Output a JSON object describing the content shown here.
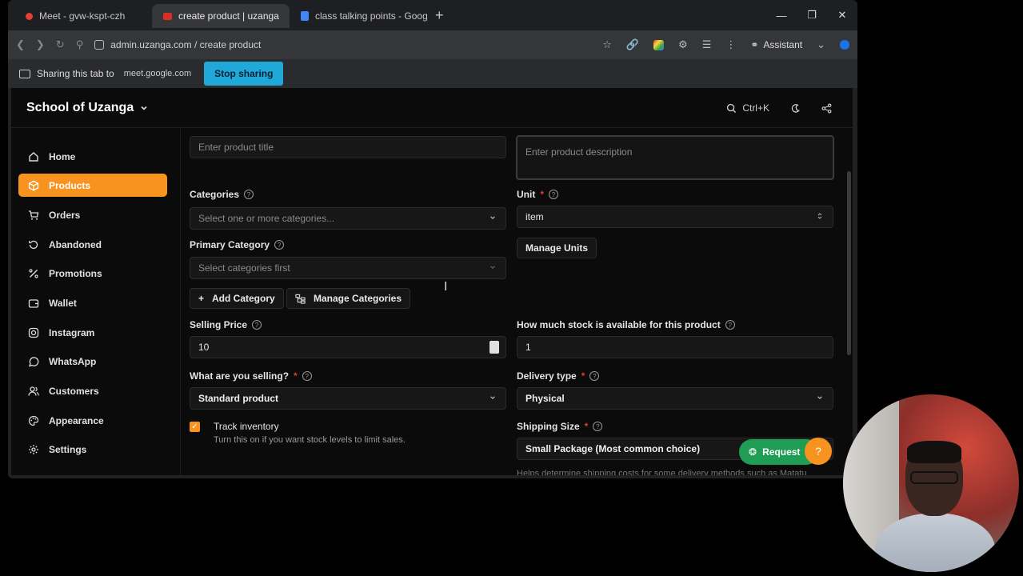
{
  "browser": {
    "tabs": [
      {
        "title": "Meet - gvw-kspt-czh",
        "active": false
      },
      {
        "title": "create product | uzanga",
        "active": true
      },
      {
        "title": "class talking points - Goog",
        "active": false
      }
    ],
    "url": "admin.uzanga.com / create product",
    "assistant_label": "Assistant"
  },
  "share_bar": {
    "text": "Sharing this tab to",
    "host": "meet.google.com",
    "stop_label": "Stop sharing"
  },
  "app": {
    "brand": "School of Uzanga",
    "search_shortcut": "Ctrl+K"
  },
  "sidebar": {
    "items": [
      {
        "label": "Home",
        "icon": "home-icon",
        "active": false
      },
      {
        "label": "Products",
        "icon": "box-icon",
        "active": true
      },
      {
        "label": "Orders",
        "icon": "cart-icon",
        "active": false
      },
      {
        "label": "Abandoned",
        "icon": "history-icon",
        "active": false
      },
      {
        "label": "Promotions",
        "icon": "percent-icon",
        "active": false
      },
      {
        "label": "Wallet",
        "icon": "wallet-icon",
        "active": false
      },
      {
        "label": "Instagram",
        "icon": "instagram-icon",
        "active": false
      },
      {
        "label": "WhatsApp",
        "icon": "whatsapp-icon",
        "active": false
      },
      {
        "label": "Customers",
        "icon": "users-icon",
        "active": false
      },
      {
        "label": "Appearance",
        "icon": "palette-icon",
        "active": false
      },
      {
        "label": "Settings",
        "icon": "gear-icon",
        "active": false
      }
    ]
  },
  "form": {
    "title_placeholder": "Enter product title",
    "description_placeholder": "Enter product description",
    "categories_label": "Categories",
    "categories_placeholder": "Select one or more categories...",
    "unit_label": "Unit",
    "unit_value": "item",
    "manage_units": "Manage Units",
    "primary_category_label": "Primary Category",
    "primary_category_placeholder": "Select categories first",
    "add_category": "Add Category",
    "manage_categories": "Manage Categories",
    "selling_price_label": "Selling Price",
    "selling_price_value": "10",
    "stock_label": "How much stock is available for this product",
    "stock_value": "1",
    "selling_type_label": "What are you selling?",
    "selling_type_value": "Standard product",
    "delivery_type_label": "Delivery type",
    "delivery_type_value": "Physical",
    "track_inventory_label": "Track inventory",
    "track_inventory_help": "Turn this on if you want stock levels to limit sales.",
    "shipping_size_label": "Shipping Size",
    "shipping_size_value": "Small Package (Most common choice)",
    "shipping_help": "Helps determine shipping costs for some delivery methods such as Matatu"
  },
  "request_button": "Request",
  "colors": {
    "accent": "#f7931e",
    "stop_sharing": "#20a8d8",
    "request": "#1f9d55"
  }
}
